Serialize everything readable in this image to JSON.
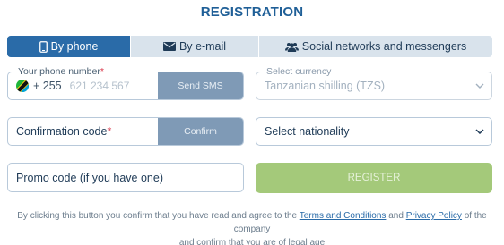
{
  "title": "REGISTRATION",
  "tabs": [
    {
      "label": "By phone",
      "icon": "phone-icon",
      "active": true
    },
    {
      "label": "By e-mail",
      "icon": "envelope-icon",
      "active": false
    },
    {
      "label": "Social networks and messengers",
      "icon": "users-icon",
      "active": false
    }
  ],
  "phone": {
    "label": "Your phone number",
    "required_mark": "*",
    "country_flag": "tanzania-flag-icon",
    "prefix": "+ 255",
    "placeholder": "621 234 567",
    "send_sms_label": "Send SMS"
  },
  "currency": {
    "label": "Select currency",
    "value": "Tanzanian shilling (TZS)"
  },
  "confirmation": {
    "label": "Confirmation code",
    "required_mark": "*",
    "confirm_label": "Confirm"
  },
  "nationality": {
    "value": "Select nationality"
  },
  "promo": {
    "placeholder": "Promo code (if you have one)"
  },
  "register_label": "REGISTER",
  "terms": {
    "prefix": "By clicking this button you confirm that you have read and agree to the",
    "terms_link": "Terms and Conditions",
    "and": "and",
    "privacy_link": "Privacy Policy",
    "suffix_line1": "of the company",
    "line2": "and confirm that you are of legal age"
  },
  "colors": {
    "accent": "#2a6ba8",
    "tab_bg": "#d9e3ec",
    "button_disabled": "#7f9ab6",
    "register_green": "#a4c97a",
    "required_red": "#d9364a"
  }
}
